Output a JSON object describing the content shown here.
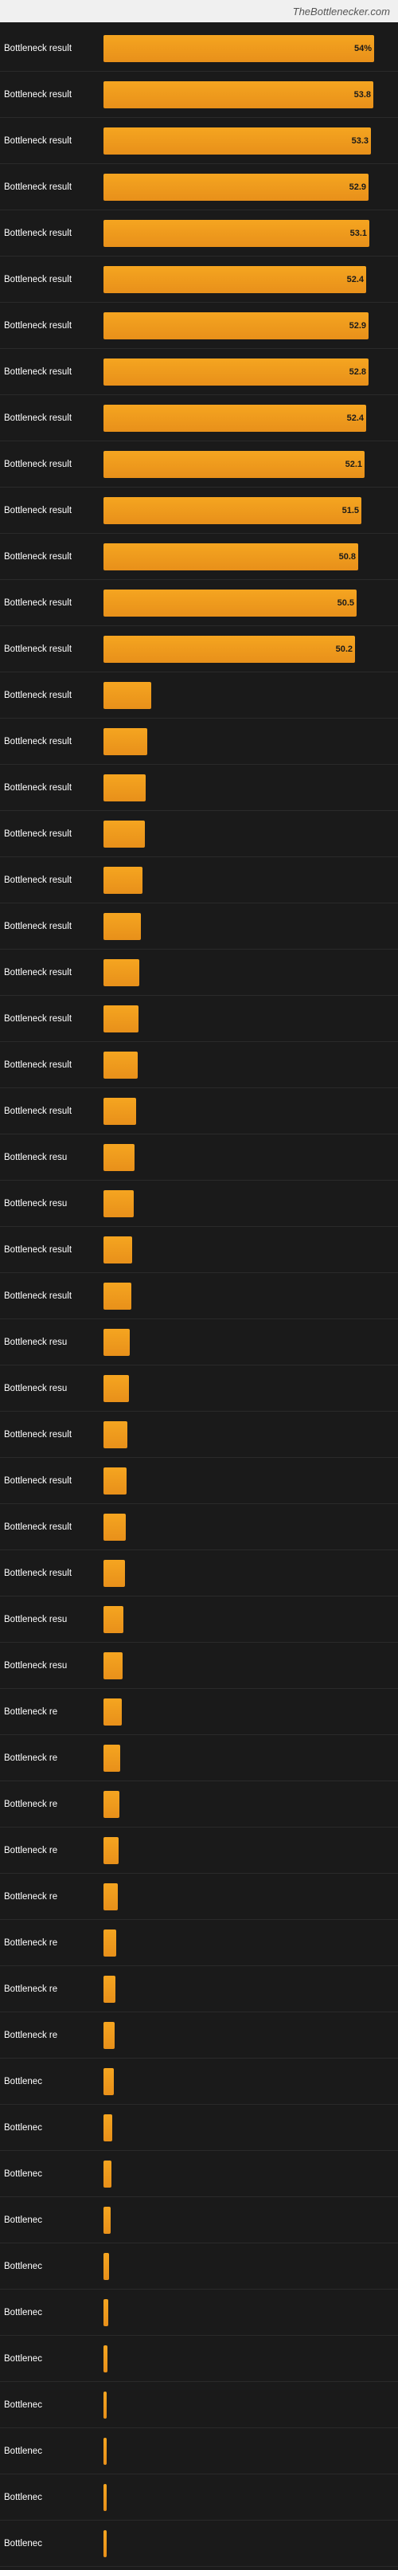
{
  "site": {
    "name": "TheBottlenecker.com"
  },
  "chart": {
    "label": "Bottleneck result",
    "bars": [
      {
        "value": 54.0,
        "display": "54%",
        "width_pct": 100
      },
      {
        "value": 53.8,
        "display": "53.8",
        "width_pct": 99.6
      },
      {
        "value": 53.3,
        "display": "53.3",
        "width_pct": 98.7
      },
      {
        "value": 52.9,
        "display": "52.9",
        "width_pct": 98.0
      },
      {
        "value": 53.1,
        "display": "53.1",
        "width_pct": 98.3
      },
      {
        "value": 52.4,
        "display": "52.4",
        "width_pct": 97.0
      },
      {
        "value": 52.9,
        "display": "52.9",
        "width_pct": 98.0
      },
      {
        "value": 52.8,
        "display": "52.8",
        "width_pct": 97.8
      },
      {
        "value": 52.4,
        "display": "52.4",
        "width_pct": 97.0
      },
      {
        "value": 52.1,
        "display": "52.1",
        "width_pct": 96.5
      },
      {
        "value": 51.5,
        "display": "51.5",
        "width_pct": 95.4
      },
      {
        "value": 50.8,
        "display": "50.8",
        "width_pct": 94.1
      },
      {
        "value": 50.5,
        "display": "50.5",
        "width_pct": 93.5
      },
      {
        "value": 50.2,
        "display": "50.2",
        "width_pct": 93.0
      },
      {
        "value": 9.5,
        "display": "",
        "width_pct": 17.6
      },
      {
        "value": 8.8,
        "display": "",
        "width_pct": 16.3
      },
      {
        "value": 8.5,
        "display": "",
        "width_pct": 15.7
      },
      {
        "value": 8.2,
        "display": "",
        "width_pct": 15.2
      },
      {
        "value": 7.8,
        "display": "",
        "width_pct": 14.4
      },
      {
        "value": 7.5,
        "display": "",
        "width_pct": 13.9
      },
      {
        "value": 7.2,
        "display": "",
        "width_pct": 13.3
      },
      {
        "value": 7.0,
        "display": "",
        "width_pct": 13.0
      },
      {
        "value": 6.8,
        "display": "",
        "width_pct": 12.6
      },
      {
        "value": 6.5,
        "display": "",
        "width_pct": 12.0
      },
      {
        "value": 6.2,
        "display": "",
        "width_pct": 11.5
      },
      {
        "value": 6.0,
        "display": "",
        "width_pct": 11.1
      },
      {
        "value": 5.8,
        "display": "",
        "width_pct": 10.7
      },
      {
        "value": 5.5,
        "display": "",
        "width_pct": 10.2
      },
      {
        "value": 5.2,
        "display": "",
        "width_pct": 9.6
      },
      {
        "value": 5.0,
        "display": "",
        "width_pct": 9.3
      },
      {
        "value": 4.8,
        "display": "",
        "width_pct": 8.9
      },
      {
        "value": 4.6,
        "display": "",
        "width_pct": 8.5
      },
      {
        "value": 4.4,
        "display": "",
        "width_pct": 8.1
      },
      {
        "value": 4.2,
        "display": "",
        "width_pct": 7.8
      },
      {
        "value": 4.0,
        "display": "",
        "width_pct": 7.4
      },
      {
        "value": 3.8,
        "display": "",
        "width_pct": 7.0
      },
      {
        "value": 3.6,
        "display": "",
        "width_pct": 6.7
      },
      {
        "value": 3.4,
        "display": "",
        "width_pct": 6.3
      },
      {
        "value": 3.2,
        "display": "",
        "width_pct": 5.9
      },
      {
        "value": 3.0,
        "display": "",
        "width_pct": 5.6
      },
      {
        "value": 2.8,
        "display": "",
        "width_pct": 5.2
      },
      {
        "value": 2.6,
        "display": "",
        "width_pct": 4.8
      },
      {
        "value": 2.4,
        "display": "",
        "width_pct": 4.4
      },
      {
        "value": 2.2,
        "display": "",
        "width_pct": 4.1
      },
      {
        "value": 2.0,
        "display": "",
        "width_pct": 3.7
      },
      {
        "value": 1.8,
        "display": "",
        "width_pct": 3.3
      },
      {
        "value": 1.6,
        "display": "",
        "width_pct": 3.0
      },
      {
        "value": 1.4,
        "display": "",
        "width_pct": 2.6
      },
      {
        "value": 1.2,
        "display": "",
        "width_pct": 2.2
      },
      {
        "value": 1.0,
        "display": "",
        "width_pct": 1.9
      },
      {
        "value": 0.8,
        "display": "",
        "width_pct": 1.5
      },
      {
        "value": 0.6,
        "display": "",
        "width_pct": 1.1
      },
      {
        "value": 0.5,
        "display": "",
        "width_pct": 0.9
      },
      {
        "value": 0.4,
        "display": "",
        "width_pct": 0.7
      },
      {
        "value": 0.3,
        "display": "",
        "width_pct": 0.6
      }
    ]
  }
}
